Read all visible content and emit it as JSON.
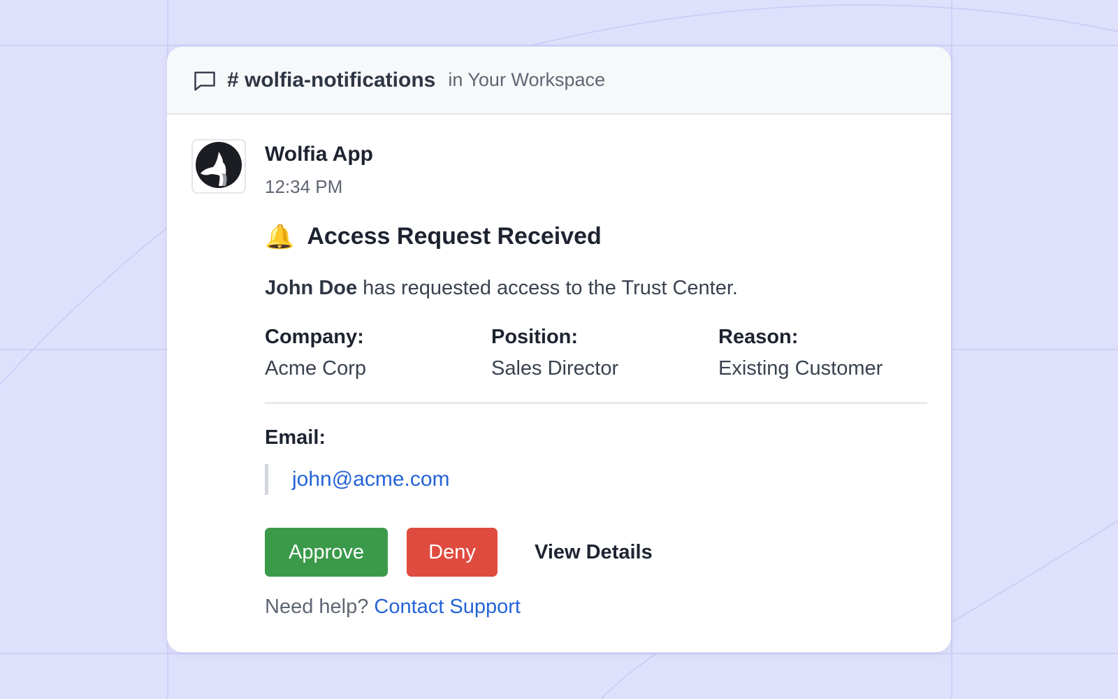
{
  "header": {
    "channel": "# wolfia-notifications",
    "workspace": "in Your Workspace"
  },
  "message": {
    "sender": "Wolfia App",
    "time": "12:34 PM",
    "bell_emoji": "🔔",
    "title": "Access Request Received",
    "requester_name": "John Doe",
    "body_text": " has requested access to the Trust Center.",
    "fields": [
      {
        "label": "Company:",
        "value": "Acme Corp"
      },
      {
        "label": "Position:",
        "value": "Sales Director"
      },
      {
        "label": "Reason:",
        "value": "Existing Customer"
      }
    ],
    "email_label": "Email:",
    "email": "john@acme.com"
  },
  "actions": {
    "approve": "Approve",
    "deny": "Deny",
    "view_details": "View Details"
  },
  "help": {
    "prefix": "Need help?",
    "link": "Contact Support"
  },
  "colors": {
    "approve": "#3b9a4a",
    "deny": "#e04b40",
    "link": "#2563d6",
    "background": "#dfe0fb"
  },
  "icons": {
    "channel": "chat-bubble-icon",
    "avatar": "wolf-logo-icon",
    "title": "bell-icon"
  }
}
